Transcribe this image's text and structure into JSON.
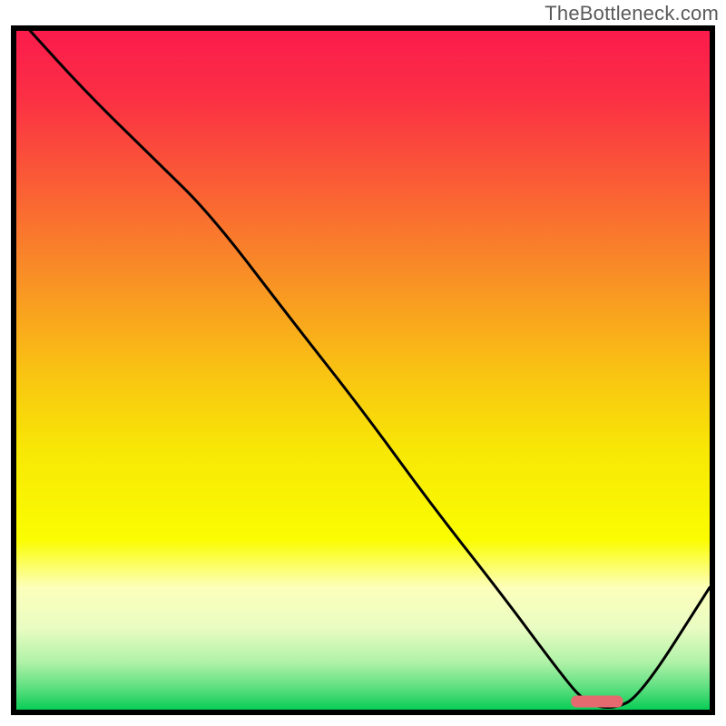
{
  "watermark": "TheBottleneck.com",
  "chart_data": {
    "type": "line",
    "title": "",
    "xlabel": "",
    "ylabel": "",
    "xlim": [
      0,
      100
    ],
    "ylim": [
      0,
      100
    ],
    "x": [
      2,
      10,
      20,
      28,
      40,
      50,
      60,
      70,
      78,
      82,
      86,
      90,
      100
    ],
    "values": [
      100,
      91,
      81,
      73,
      57,
      44,
      30,
      17,
      6,
      1,
      0,
      2,
      18
    ],
    "marker": {
      "x_start": 80,
      "x_end": 87.5,
      "y": 1.2,
      "color": "#e46a6f"
    },
    "gradient_stops": [
      {
        "offset": 0.0,
        "color": "#fb1b4c"
      },
      {
        "offset": 0.1,
        "color": "#fb3044"
      },
      {
        "offset": 0.22,
        "color": "#fa5b36"
      },
      {
        "offset": 0.35,
        "color": "#f98b27"
      },
      {
        "offset": 0.5,
        "color": "#f9c213"
      },
      {
        "offset": 0.62,
        "color": "#f8e805"
      },
      {
        "offset": 0.75,
        "color": "#fafd01"
      },
      {
        "offset": 0.82,
        "color": "#fdffbb"
      },
      {
        "offset": 0.88,
        "color": "#e9fcc2"
      },
      {
        "offset": 0.93,
        "color": "#b0f2a8"
      },
      {
        "offset": 0.97,
        "color": "#58de7d"
      },
      {
        "offset": 1.0,
        "color": "#09cd56"
      }
    ]
  },
  "plot": {
    "outer_x": 12,
    "outer_y": 28,
    "outer_w": 776,
    "outer_h": 760,
    "border_color": "#000000",
    "border_width": 6,
    "line_color": "#000000",
    "line_width": 3
  }
}
